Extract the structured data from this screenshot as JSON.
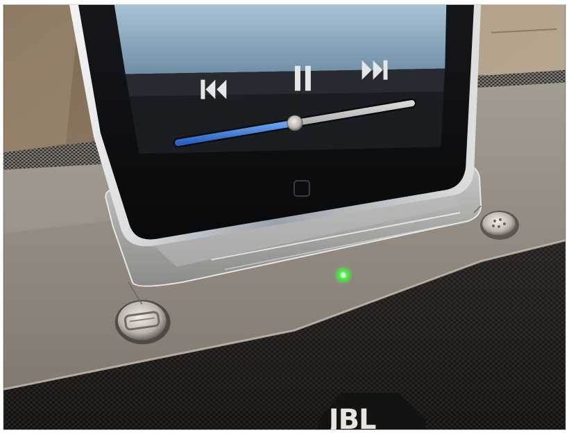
{
  "photo": {
    "subject": "jbl-speaker-dock-with-media-player",
    "brand_logo_text": "JBL",
    "player_controls": {
      "icons": [
        "previous-track-icon",
        "pause-icon",
        "next-track-icon"
      ],
      "volume_level": 0.5
    },
    "status_led_color": "#3cff3c",
    "colors": {
      "dock_top": "#9a938a",
      "grille": "#2b2926",
      "player_screen": "#1a1d22",
      "volume_fill": "#3b78d8"
    }
  }
}
